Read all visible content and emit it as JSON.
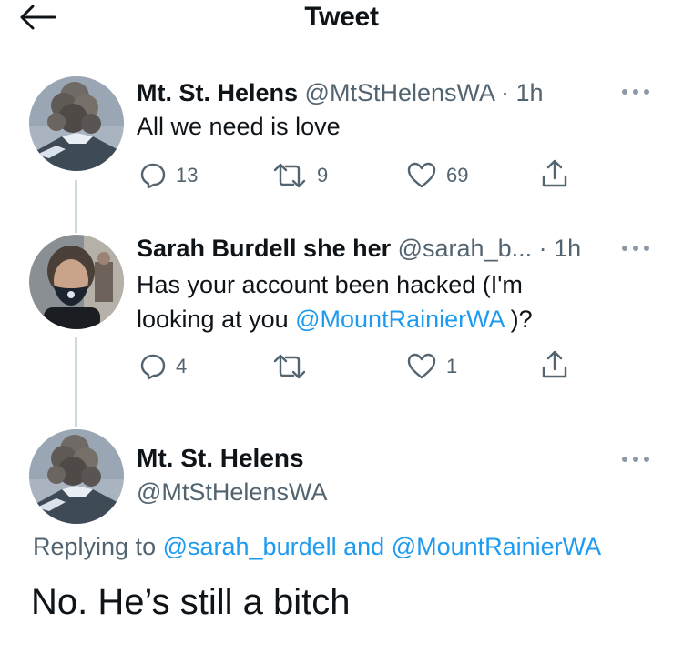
{
  "header": {
    "title": "Tweet"
  },
  "tweets": [
    {
      "name": "Mt. St. Helens",
      "handle": "@MtStHelensWA",
      "time": "· 1h",
      "text": "All we need is love",
      "replies": "13",
      "retweets": "9",
      "likes": "69"
    },
    {
      "name": "Sarah Burdell she her",
      "handle": "@sarah_b...",
      "time": "· 1h",
      "text_before": "Has your account been hacked (I'm looking at you ",
      "mention": "@MountRainierWA",
      "text_after": " )?",
      "replies": "4",
      "retweets": "",
      "likes": "1"
    }
  ],
  "main_tweet": {
    "name": "Mt. St. Helens",
    "handle": "@MtStHelensWA",
    "replying_prefix": "Replying to ",
    "replying_user1": "@sarah_burdell",
    "replying_and": " and ",
    "replying_user2": "@MountRainierWA",
    "text": "No. He’s still a bitch"
  },
  "colors": {
    "accent": "#1d9bf0",
    "secondary_text": "#536471",
    "thread_line": "#cfd9de"
  }
}
